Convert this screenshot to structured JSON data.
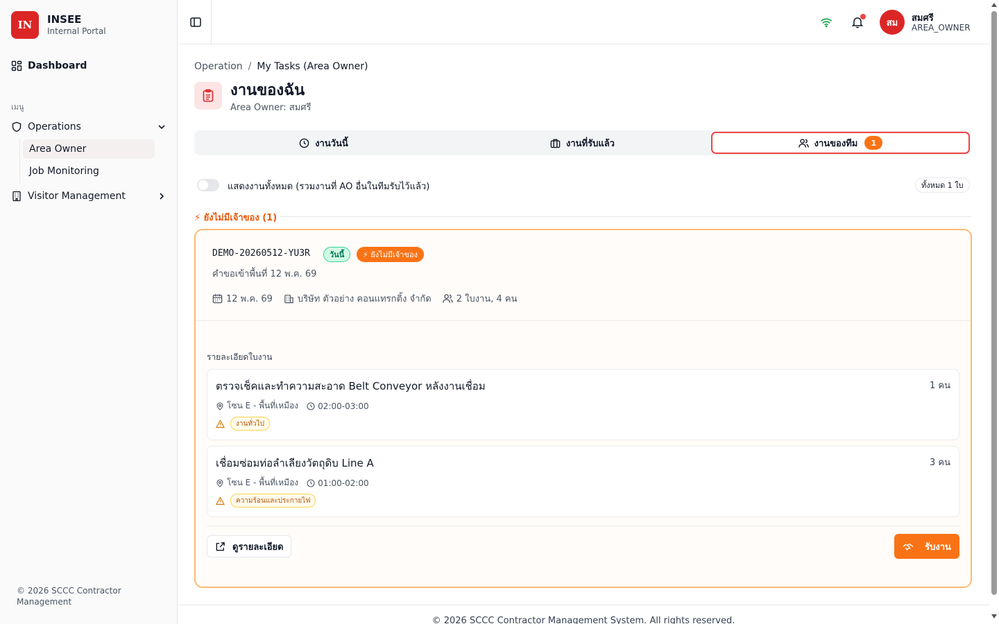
{
  "brand": {
    "logo": "IN",
    "name": "INSEE",
    "subtitle": "Internal Portal"
  },
  "sidebar": {
    "dashboard": "Dashboard",
    "group_label": "เมนู",
    "operations": "Operations",
    "sub_items": [
      "Area Owner",
      "Job Monitoring"
    ],
    "visitor": "Visitor Management",
    "footer": "© 2026 SCCC Contractor Management"
  },
  "topbar": {
    "user": {
      "initials": "สม",
      "name": "สมศรี",
      "role": "AREA_OWNER"
    }
  },
  "breadcrumb": {
    "parent": "Operation",
    "separator": "/",
    "current": "My Tasks (Area Owner)"
  },
  "page": {
    "title": "งานของฉัน",
    "subtitle": "Area Owner: สมศรี"
  },
  "tabs": [
    {
      "label": "งานวันนี้",
      "icon": "clock-icon"
    },
    {
      "label": "งานที่รับแล้ว",
      "icon": "briefcase-icon"
    },
    {
      "label": "งานของทีม",
      "icon": "users-icon",
      "badge": "1",
      "active": true
    }
  ],
  "filter": {
    "show_all_label": "แสดงงานทั้งหมด (รวมงานที่ AO อื่นในทีมรับไว้แล้ว)",
    "show_all_on": false,
    "count_label": "ทั้งหมด 1 ใบ"
  },
  "section": {
    "title": "⚡ ยังไม่มีเจ้าของ (1)"
  },
  "request": {
    "id": "DEMO-20260512-YU3R",
    "today_badge": "วันนี้",
    "owner_badge": "⚡ ยังไม่มีเจ้าของ",
    "description": "คำขอเข้าพื้นที่ 12 พ.ค. 69",
    "date": "12 พ.ค. 69",
    "company": "บริษัท ตัวอย่าง คอนแทรกติ้ง จำกัด",
    "summary": "2 ใบงาน, 4 คน",
    "detail_title": "รายละเอียดใบงาน",
    "work_permits": [
      {
        "title": "ตรวจเช็คและทำความสะอาด Belt Conveyor หลังงานเชื่อม",
        "count": "1 คน",
        "location": "โซน E - พื้นที่เหมือง",
        "time": "02:00-03:00",
        "risk": "งานทั่วไป"
      },
      {
        "title": "เชื่อมซ่อมท่อลำเลียงวัตถุดิบ Line A",
        "count": "3 คน",
        "location": "โซน E - พื้นที่เหมือง",
        "time": "01:00-02:00",
        "risk": "ความร้อนและประกายไฟ"
      }
    ],
    "detail_button": "ดูรายละเอียด",
    "accept_button": "รับงาน"
  },
  "footer": {
    "text": "© 2026 SCCC Contractor Management System. All rights reserved."
  },
  "colors": {
    "brand": "#dc2626",
    "accent": "#f97316",
    "success": "#047857"
  }
}
